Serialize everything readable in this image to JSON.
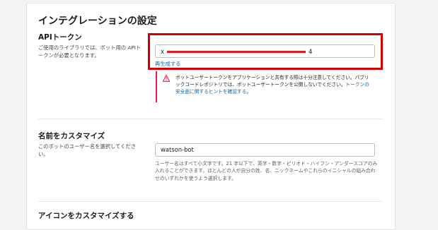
{
  "page": {
    "title": "インテグレーションの設定"
  },
  "api_token": {
    "label": "APIトークン",
    "description": "ご使用のライブラリでは、ボット用の APIトークンが必要となります。",
    "value_first_char": "x",
    "value_last_char": "4",
    "regenerate_label": "再生成する",
    "warning_text": "ボットユーザートークンをアプリケーションと共有する際は十分注意してください。パブリックコードレポジトリでは、ボットユーザートークンを公開しないでください。",
    "warning_link": "トークンの安全面に関するヒントを確認する",
    "warning_tail": "。",
    "colors": {
      "highlight": "#d60000",
      "warning": "#e01e5a",
      "link": "#1264a3"
    },
    "icon": "warning-triangle-icon"
  },
  "name": {
    "label": "名前をカスタマイズ",
    "description": "このボットのユーザー名を選択してください。",
    "value": "watson-bot",
    "help": "ユーザー名はすべて小文字です。21 字以下で、英字・数字・ピリオド・ハイフン・アンダースコアのみ入れることができます。ほとんどの人が自分の姓、名、ニックネームやこれらのイニシャルの組み合わせのいずれかを使うよう選択します。"
  },
  "icon_section": {
    "label": "アイコンをカスタマイズする"
  }
}
